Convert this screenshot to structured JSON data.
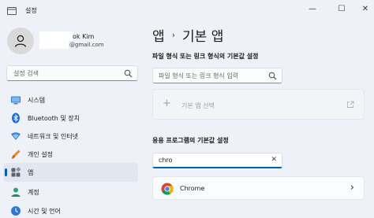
{
  "window": {
    "title": "설정",
    "icon": "settings-app-icon",
    "controls": {
      "minimize": "—",
      "maximize": "☐",
      "close": "✕"
    }
  },
  "user": {
    "name": "ok Kim",
    "email": "@gmail.com"
  },
  "sidebar": {
    "search_placeholder": "설정 검색",
    "items": [
      {
        "label": "시스템",
        "icon": "system-icon"
      },
      {
        "label": "Bluetooth 및 장치",
        "icon": "bluetooth-icon"
      },
      {
        "label": "네트워크 및 인터넷",
        "icon": "network-icon"
      },
      {
        "label": "개인 설정",
        "icon": "personalization-icon"
      },
      {
        "label": "앱",
        "icon": "apps-icon",
        "active": true
      },
      {
        "label": "계정",
        "icon": "account-icon"
      },
      {
        "label": "시간 및 언어",
        "icon": "time-language-icon"
      }
    ]
  },
  "main": {
    "breadcrumb": {
      "parent": "앱",
      "separator": "›",
      "current": "기본 앱"
    },
    "file_section": {
      "title": "파일 형식 또는 링크 형식의 기본값 설정",
      "input_placeholder": "파일 형식 또는 링크 형식 입력",
      "button_label": "기본 앱 선택",
      "button_icon": "plus-icon",
      "open_icon": "open-external-icon"
    },
    "app_section": {
      "title": "응용 프로그램의 기본값 설정",
      "search_value": "chro",
      "result": {
        "name": "Chrome",
        "icon": "chrome-icon",
        "chevron": "›"
      }
    }
  },
  "colors": {
    "accent": "#005fb8",
    "background": "#eef2f8",
    "card": "#f7f9fb"
  }
}
